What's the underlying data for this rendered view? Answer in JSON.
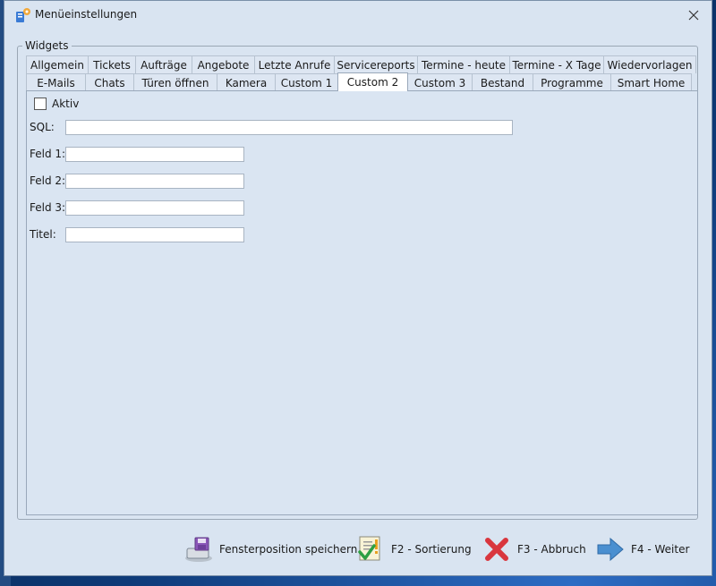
{
  "window": {
    "title": "Menüeinstellungen"
  },
  "group": {
    "legend": "Widgets"
  },
  "tabs_row1": [
    "Allgemein",
    "Tickets",
    "Aufträge",
    "Angebote",
    "Letzte Anrufe",
    "Servicereports",
    "Termine - heute",
    "Termine - X Tage",
    "Wiedervorlagen"
  ],
  "tabs_row2": [
    "E-Mails",
    "Chats",
    "Türen öffnen",
    "Kamera",
    "Custom 1",
    "Custom 2",
    "Custom 3",
    "Bestand",
    "Programme",
    "Smart Home"
  ],
  "active_tab": "Custom 2",
  "form": {
    "aktiv_label": "Aktiv",
    "aktiv_checked": false,
    "sql_label": "SQL:",
    "sql_value": "",
    "feld1_label": "Feld 1:",
    "feld1_value": "",
    "feld2_label": "Feld 2:",
    "feld2_value": "",
    "feld3_label": "Feld 3:",
    "feld3_value": "",
    "titel_label": "Titel:",
    "titel_value": ""
  },
  "footer": {
    "save_position": "Fensterposition speichern",
    "sort": "F2 - Sortierung",
    "cancel": "F3 - Abbruch",
    "next": "F4 - Weiter"
  },
  "colors": {
    "window_bg": "#d9e4f1",
    "active_tab_bg": "#ffffff",
    "cancel_red": "#d9363e",
    "next_blue": "#4a8fd0"
  }
}
